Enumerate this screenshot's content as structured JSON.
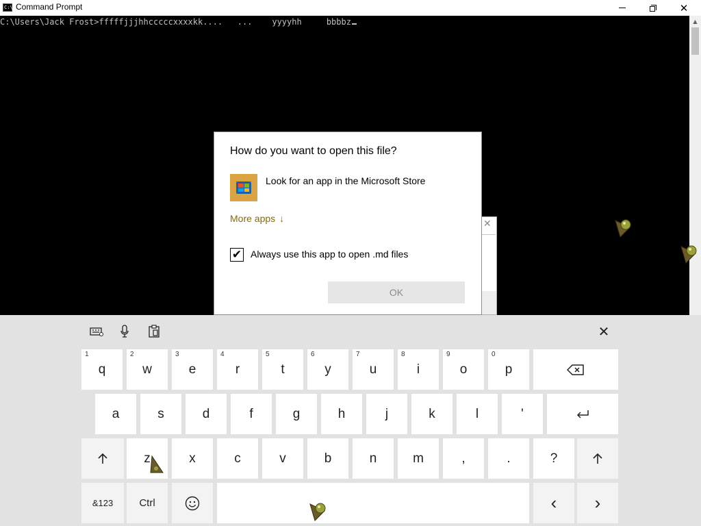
{
  "window": {
    "title": "Command Prompt",
    "icon_text": "C:\\"
  },
  "console": {
    "prompt_line": "C:\\Users\\Jack Frost>fffffjjjhhcccccxxxxkk....   ...    yyyyhh     bbbbz"
  },
  "dialog": {
    "title": "How do you want to open this file?",
    "store_option": "Look for an app in the Microsoft Store",
    "more_apps": "More apps",
    "more_apps_arrow": "↓",
    "checkbox_label": "Always use this app to open .md files",
    "checkbox_checked": true,
    "ok_label": "OK"
  },
  "keyboard": {
    "row1": [
      {
        "num": "1",
        "label": "q"
      },
      {
        "num": "2",
        "label": "w"
      },
      {
        "num": "3",
        "label": "e"
      },
      {
        "num": "4",
        "label": "r"
      },
      {
        "num": "5",
        "label": "t"
      },
      {
        "num": "6",
        "label": "y"
      },
      {
        "num": "7",
        "label": "u"
      },
      {
        "num": "8",
        "label": "i"
      },
      {
        "num": "9",
        "label": "o"
      },
      {
        "num": "0",
        "label": "p"
      }
    ],
    "row2": [
      "a",
      "s",
      "d",
      "f",
      "g",
      "h",
      "j",
      "k",
      "l",
      "'"
    ],
    "row3": [
      "z",
      "x",
      "c",
      "v",
      "b",
      "n",
      "m",
      ",",
      ".",
      "?"
    ],
    "symbols_label": "&123",
    "ctrl_label": "Ctrl",
    "backspace_icon": "backspace-icon",
    "enter_icon": "enter-icon",
    "shift_icon": "shift-icon",
    "emoji_icon": "emoji-icon",
    "left_arrow": "‹",
    "right_arrow": "›",
    "close_icon": "close-icon"
  },
  "colors": {
    "accent_link": "#8a6d00",
    "store_tile": "#d9a441"
  }
}
